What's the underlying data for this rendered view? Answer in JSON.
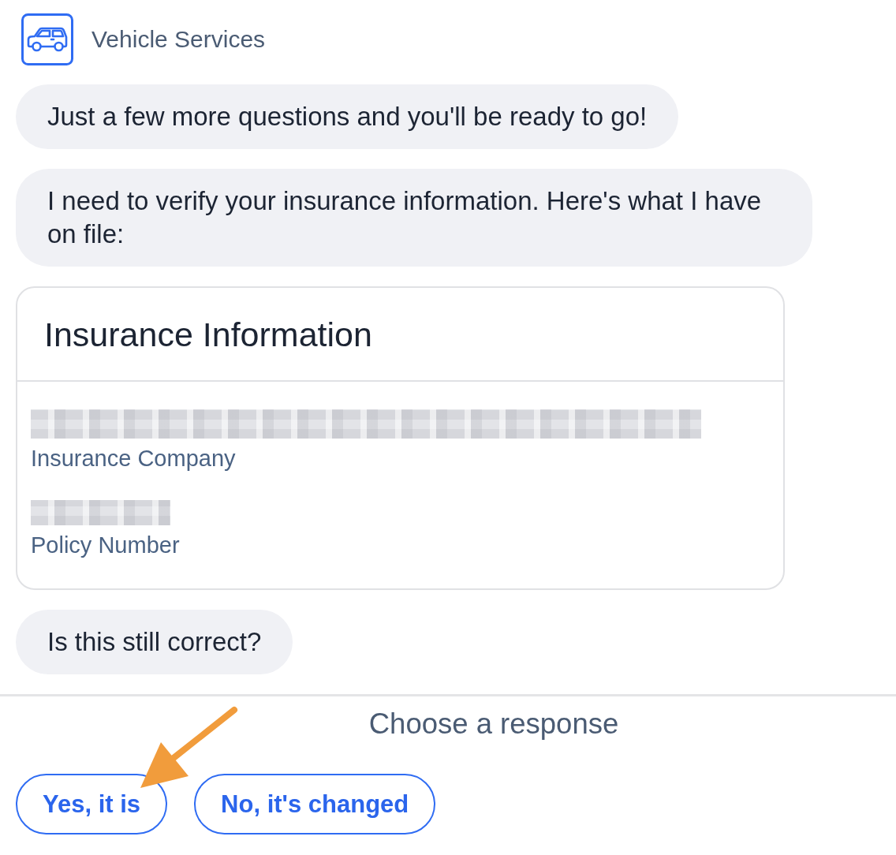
{
  "header": {
    "title": "Vehicle Services"
  },
  "messages": [
    {
      "kind": "bubble",
      "text": "Just a few more questions and you'll be ready to go!"
    },
    {
      "kind": "bubble",
      "text": "I need to verify your insurance information. Here's what I have on file:"
    },
    {
      "kind": "card",
      "title": "Insurance Information",
      "fields": [
        {
          "kind": "wide",
          "label": "Insurance Company"
        },
        {
          "kind": "narrow",
          "label": "Policy Number"
        }
      ]
    },
    {
      "kind": "bubble",
      "text": "Is this still correct?"
    }
  ],
  "response_panel": {
    "prompt": "Choose a response",
    "options": [
      {
        "label": "Yes, it is",
        "annotated": true
      },
      {
        "label": "No, it's changed",
        "annotated": false
      }
    ]
  }
}
